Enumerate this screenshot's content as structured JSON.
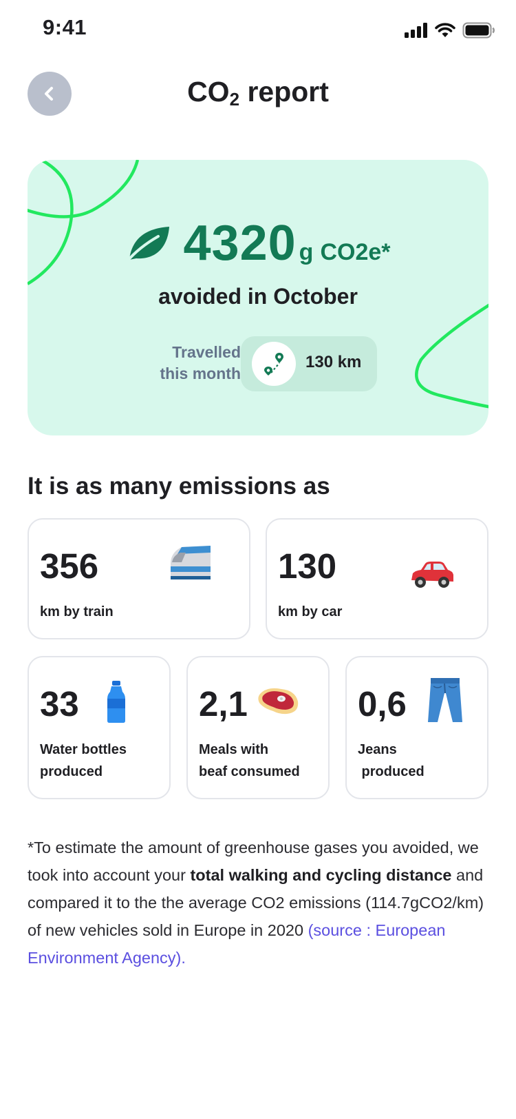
{
  "status_bar": {
    "time": "9:41"
  },
  "header": {
    "title_prefix": "CO",
    "title_sub": "2",
    "title_suffix": " report"
  },
  "hero": {
    "value": "4320",
    "unit_g": "g",
    "unit": "CO2e*",
    "subtitle": "avoided in October",
    "travel_label_line1": "Travelled",
    "travel_label_line2": "this month",
    "travel_value": "130 km",
    "colors": {
      "background": "#d7f8ec",
      "accent": "#137a55",
      "deco_stroke": "#22e85f"
    }
  },
  "section": {
    "title": "It is as many emissions as"
  },
  "equivalents": [
    {
      "value": "356",
      "label": "km by train",
      "icon": "train-icon"
    },
    {
      "value": "130",
      "label": "km by car",
      "icon": "car-icon"
    },
    {
      "value": "33",
      "label": "Water bottles\nproduced",
      "icon": "water-bottle-icon"
    },
    {
      "value": "2,1",
      "label": "Meals with\nbeaf consumed",
      "icon": "steak-icon"
    },
    {
      "value": "0,6",
      "label": "Jeans\n produced",
      "icon": "jeans-icon"
    }
  ],
  "footnote": {
    "part1": "*To estimate the amount of greenhouse gases you avoided, we took into account your ",
    "bold": "total walking and cycling distance",
    "part2": " and compared it to the the average CO2 emissions (114.7gCO2/km) of new vehicles sold in Europe in 2020 ",
    "source_link": "(source : European Environment Agency).",
    "link_color": "#5b4fe0"
  }
}
